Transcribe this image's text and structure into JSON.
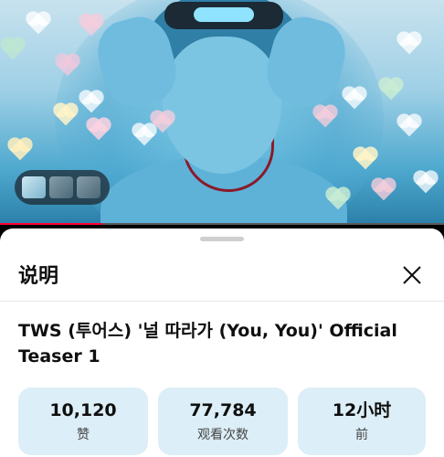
{
  "player": {
    "progress_fraction": 0.23,
    "progress_color": "#ff0033"
  },
  "description": {
    "heading": "说明",
    "close_icon": "close-icon",
    "video_title": "TWS (투어스) '널 따라가 (You, You)' Official Teaser 1",
    "stats": [
      {
        "value": "10,120",
        "label": "赞"
      },
      {
        "value": "77,784",
        "label": "观看次数"
      },
      {
        "value": "12小时",
        "label": "前"
      }
    ]
  },
  "colors": {
    "stat_bg": "#dceef7",
    "sheet_bg": "#ffffff"
  }
}
